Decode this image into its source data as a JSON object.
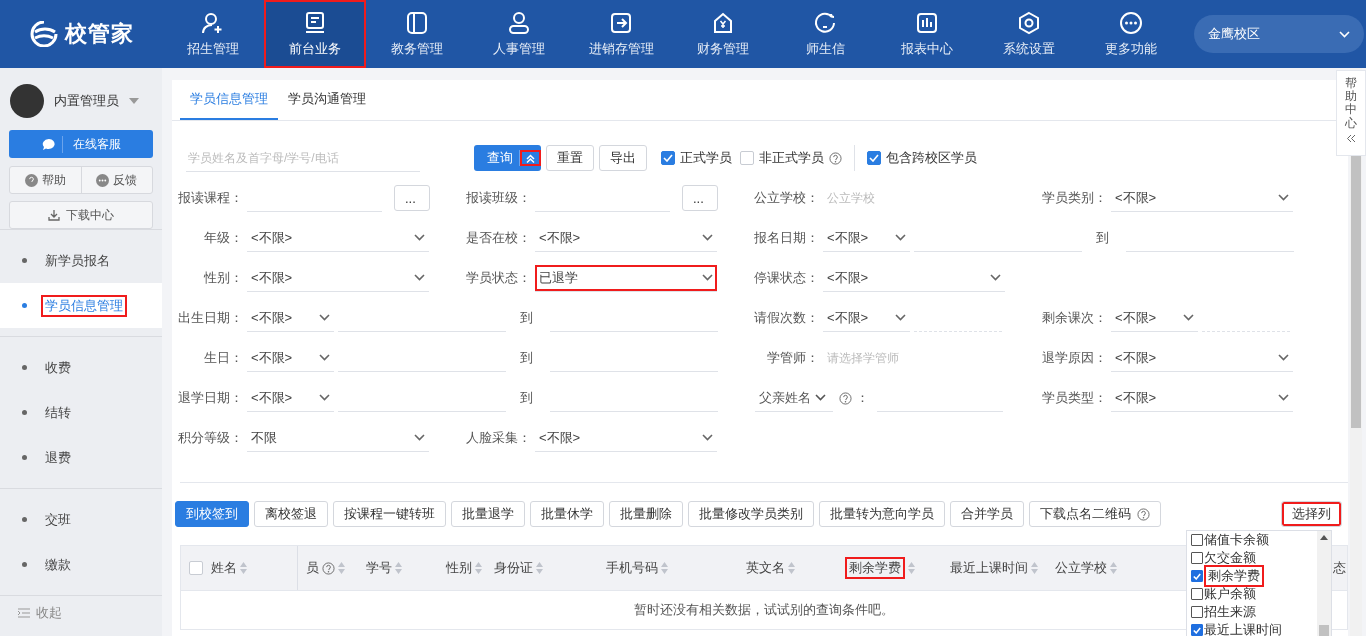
{
  "header": {
    "logo": "校管家",
    "nav": [
      {
        "label": "招生管理",
        "selected": false,
        "highlighted": false
      },
      {
        "label": "前台业务",
        "selected": true,
        "highlighted": true
      },
      {
        "label": "教务管理",
        "selected": false,
        "highlighted": false
      },
      {
        "label": "人事管理",
        "selected": false,
        "highlighted": false
      },
      {
        "label": "进销存管理",
        "selected": false,
        "highlighted": false
      },
      {
        "label": "财务管理",
        "selected": false,
        "highlighted": false
      },
      {
        "label": "师生信",
        "selected": false,
        "highlighted": false
      },
      {
        "label": "报表中心",
        "selected": false,
        "highlighted": false
      },
      {
        "label": "系统设置",
        "selected": false,
        "highlighted": false
      },
      {
        "label": "更多功能",
        "selected": false,
        "highlighted": false
      }
    ],
    "campus": "金鹰校区"
  },
  "sidebar": {
    "user": "内置管理员",
    "service_button": "在线客服",
    "help_button": "帮助",
    "feedback_button": "反馈",
    "download_button": "下载中心",
    "menu_groups": [
      [
        {
          "label": "新学员报名",
          "selected": false,
          "highlighted": false
        },
        {
          "label": "学员信息管理",
          "selected": true,
          "highlighted": true
        }
      ],
      [
        {
          "label": "收费",
          "selected": false,
          "highlighted": false
        },
        {
          "label": "结转",
          "selected": false,
          "highlighted": false
        },
        {
          "label": "退费",
          "selected": false,
          "highlighted": false
        }
      ],
      [
        {
          "label": "交班",
          "selected": false,
          "highlighted": false
        },
        {
          "label": "缴款",
          "selected": false,
          "highlighted": false
        }
      ]
    ],
    "collapse": "收起"
  },
  "help_tab": "帮助中心",
  "tabs": [
    {
      "label": "学员信息管理",
      "selected": true
    },
    {
      "label": "学员沟通管理",
      "selected": false
    }
  ],
  "search": {
    "placeholder": "学员姓名及首字母/学号/电话",
    "query_button": "查询",
    "toggle_highlighted": true,
    "reset_button": "重置",
    "export_button": "导出",
    "checkbox_groups": [
      [
        {
          "label": "正式学员",
          "checked": true,
          "help": false
        },
        {
          "label": "非正式学员",
          "checked": false,
          "help": true
        }
      ],
      [
        {
          "label": "包含跨校区学员",
          "checked": true,
          "help": false
        }
      ]
    ]
  },
  "filters": [
    [
      {
        "kind": "picker",
        "label": "报读课程：",
        "button": "..."
      },
      {
        "kind": "picker",
        "label": "报读班级：",
        "button": "..."
      },
      {
        "kind": "input",
        "label": "公立学校：",
        "placeholder": "公立学校"
      },
      {
        "kind": "select",
        "label": "学员类别：",
        "value": "<不限>",
        "highlighted": false
      }
    ],
    [
      {
        "kind": "select",
        "label": "年级：",
        "value": "<不限>",
        "highlighted": false
      },
      {
        "kind": "select",
        "label": "是否在校：",
        "value": "<不限>",
        "highlighted": false
      },
      {
        "kind": "date-range",
        "label": "报名日期：",
        "value": "<不限>",
        "separator": "到"
      }
    ],
    [
      {
        "kind": "select",
        "label": "性别：",
        "value": "<不限>",
        "highlighted": false
      },
      {
        "kind": "select",
        "label": "学员状态：",
        "value": "已退学",
        "highlighted": true
      },
      {
        "kind": "select",
        "label": "停课状态：",
        "value": "<不限>",
        "highlighted": false
      }
    ],
    [
      {
        "kind": "date-range",
        "label": "出生日期：",
        "value": "<不限>",
        "separator": "到"
      },
      {
        "kind": "number-range",
        "label": "请假次数：",
        "value": "<不限>"
      },
      {
        "kind": "number-range",
        "label": "剩余课次：",
        "value": "<不限>"
      }
    ],
    [
      {
        "kind": "date-range",
        "label": "生日：",
        "value": "<不限>",
        "separator": "到"
      },
      {
        "kind": "input",
        "label": "学管师：",
        "placeholder": "请选择学管师"
      },
      {
        "kind": "select",
        "label": "退学原因：",
        "value": "<不限>",
        "highlighted": false
      }
    ],
    [
      {
        "kind": "date-range",
        "label": "退学日期：",
        "value": "<不限>",
        "separator": "到"
      },
      {
        "kind": "field-select",
        "value": "父亲姓名",
        "colon": "："
      },
      {
        "kind": "select",
        "label": "学员类型：",
        "value": "<不限>",
        "highlighted": false
      }
    ],
    [
      {
        "kind": "select",
        "label": "积分等级：",
        "value": "不限",
        "highlighted": false
      },
      {
        "kind": "select",
        "label": "人脸采集：",
        "value": "<不限>",
        "highlighted": false
      }
    ]
  ],
  "actions": [
    {
      "label": "到校签到",
      "primary": true,
      "help": false
    },
    {
      "label": "离校签退",
      "primary": false,
      "help": false
    },
    {
      "label": "按课程一键转班",
      "primary": false,
      "help": false
    },
    {
      "label": "批量退学",
      "primary": false,
      "help": false
    },
    {
      "label": "批量休学",
      "primary": false,
      "help": false
    },
    {
      "label": "批量删除",
      "primary": false,
      "help": false
    },
    {
      "label": "批量修改学员类别",
      "primary": false,
      "help": false
    },
    {
      "label": "批量转为意向学员",
      "primary": false,
      "help": false
    },
    {
      "label": "合并学员",
      "primary": false,
      "help": false
    },
    {
      "label": "下载点名二维码",
      "primary": false,
      "help": true
    }
  ],
  "column_button": {
    "label": "选择列",
    "highlighted": true
  },
  "table": {
    "columns": [
      {
        "label": "姓名",
        "help": false,
        "sortable": true,
        "highlighted": false
      },
      {
        "label": "员",
        "help": true,
        "sortable": true,
        "highlighted": false
      },
      {
        "label": "学号",
        "help": false,
        "sortable": true,
        "highlighted": false
      },
      {
        "label": "性别",
        "help": false,
        "sortable": true,
        "highlighted": false
      },
      {
        "label": "身份证",
        "help": false,
        "sortable": true,
        "highlighted": false
      },
      {
        "label": "手机号码",
        "help": false,
        "sortable": true,
        "highlighted": false
      },
      {
        "label": "英文名",
        "help": false,
        "sortable": true,
        "highlighted": false
      },
      {
        "label": "剩余学费",
        "help": false,
        "sortable": true,
        "highlighted": true
      },
      {
        "label": "最近上课时间",
        "help": false,
        "sortable": true,
        "highlighted": false
      },
      {
        "label": "公立学校",
        "help": false,
        "sortable": true,
        "highlighted": false
      },
      {
        "label": "态",
        "highlighted": false
      }
    ],
    "select_all_checked": false,
    "empty_text": "暂时还没有相关数据，试试别的查询条件吧。"
  },
  "column_picker": {
    "options": [
      {
        "label": "储值卡余额",
        "checked": false,
        "highlighted": false
      },
      {
        "label": "欠交金额",
        "checked": false,
        "highlighted": false
      },
      {
        "label": "剩余学费",
        "checked": true,
        "highlighted": true
      },
      {
        "label": "账户余额",
        "checked": false,
        "highlighted": false
      },
      {
        "label": "招生来源",
        "checked": false,
        "highlighted": false
      },
      {
        "label": "最近上课时间",
        "checked": true,
        "highlighted": false
      }
    ]
  }
}
